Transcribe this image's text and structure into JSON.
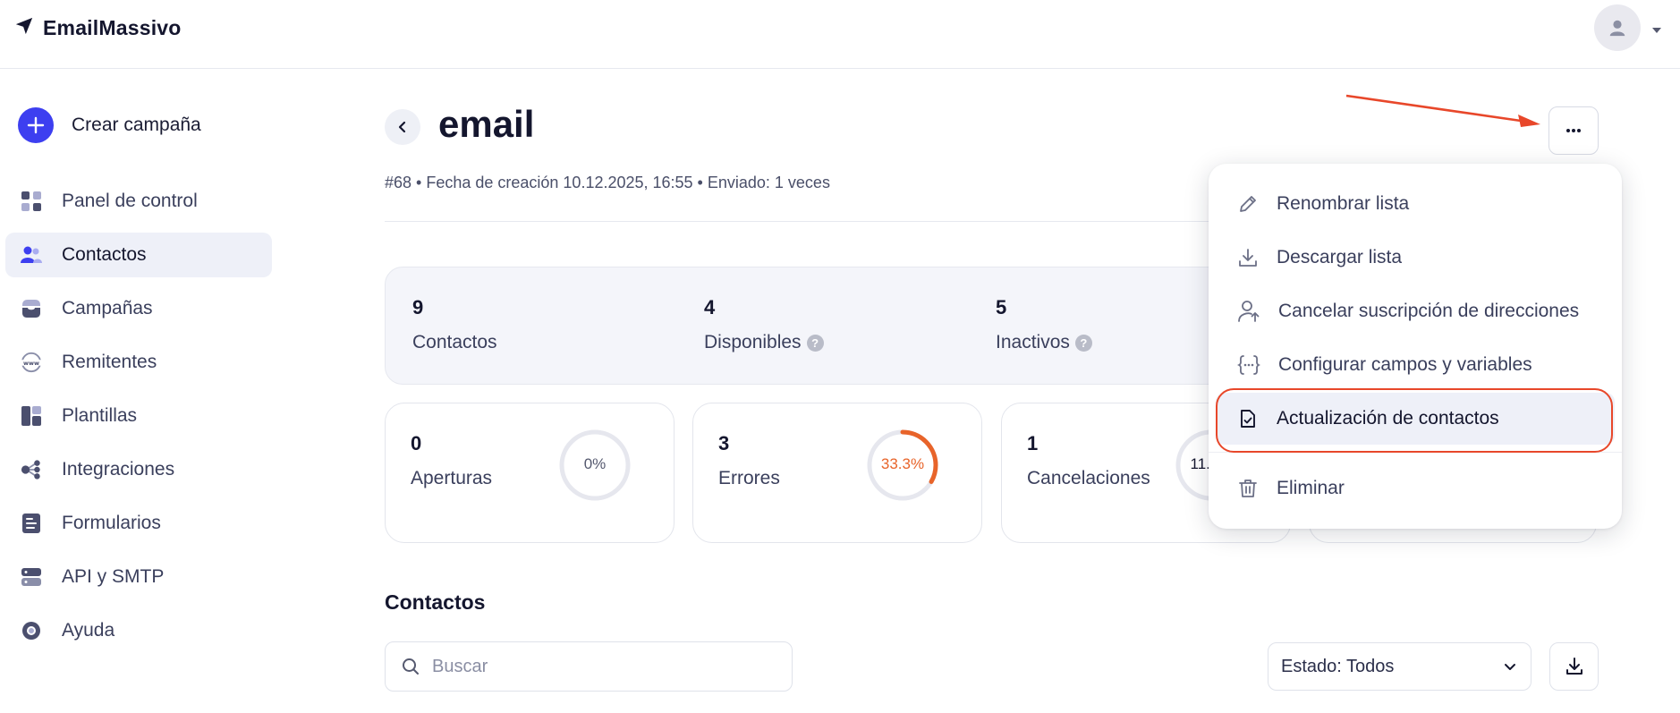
{
  "app": {
    "name": "EmailMassivo"
  },
  "sidebar": {
    "create_label": "Crear campaña",
    "items": [
      {
        "label": "Panel de control",
        "icon": "dashboard-icon",
        "active": false
      },
      {
        "label": "Contactos",
        "icon": "users-icon",
        "active": true
      },
      {
        "label": "Campañas",
        "icon": "inbox-icon",
        "active": false
      },
      {
        "label": "Remitentes",
        "icon": "globe-www-icon",
        "active": false
      },
      {
        "label": "Plantillas",
        "icon": "templates-icon",
        "active": false
      },
      {
        "label": "Integraciones",
        "icon": "integrations-icon",
        "active": false
      },
      {
        "label": "Formularios",
        "icon": "form-icon",
        "active": false
      },
      {
        "label": "API y SMTP",
        "icon": "server-icon",
        "active": false
      },
      {
        "label": "Ayuda",
        "icon": "lifebuoy-icon",
        "active": false
      }
    ]
  },
  "page": {
    "title": "email",
    "meta": "#68 • Fecha de creación 10.12.2025, 16:55 • Enviado: 1 veces"
  },
  "stats": [
    {
      "num": "9",
      "label": "Contactos",
      "help": false
    },
    {
      "num": "4",
      "label": "Disponibles",
      "help": true
    },
    {
      "num": "5",
      "label": "Inactivos",
      "help": true
    }
  ],
  "cards": [
    {
      "num": "0",
      "label": "Aperturas",
      "percent_text": "0%",
      "percent": 0,
      "color": "#e6e7ee",
      "text_color": "#55596f"
    },
    {
      "num": "3",
      "label": "Errores",
      "percent_text": "33.3%",
      "percent": 33.3,
      "color": "#e8642a",
      "text_color": "#e8642a"
    },
    {
      "num": "1",
      "label": "Cancelaciones",
      "percent_text": "11.1%",
      "percent": 11.1,
      "color": "#1f2340",
      "text_color": "#14162e"
    }
  ],
  "contacts_section": {
    "title": "Contactos",
    "search_placeholder": "Buscar",
    "status_filter": "Estado: Todos"
  },
  "menu": {
    "items": [
      {
        "label": "Renombrar lista",
        "icon": "pencil-icon"
      },
      {
        "label": "Descargar lista",
        "icon": "download-icon"
      },
      {
        "label": "Cancelar suscripción de direcciones",
        "icon": "user-unsubscribe-icon"
      },
      {
        "label": "Configurar campos y variables",
        "icon": "braces-icon"
      },
      {
        "label": "Actualización de contactos",
        "icon": "file-check-icon",
        "highlighted": true
      },
      {
        "label": "Eliminar",
        "icon": "trash-icon"
      }
    ]
  },
  "colors": {
    "accent": "#3d3ff0",
    "annotation": "#e8472a"
  }
}
